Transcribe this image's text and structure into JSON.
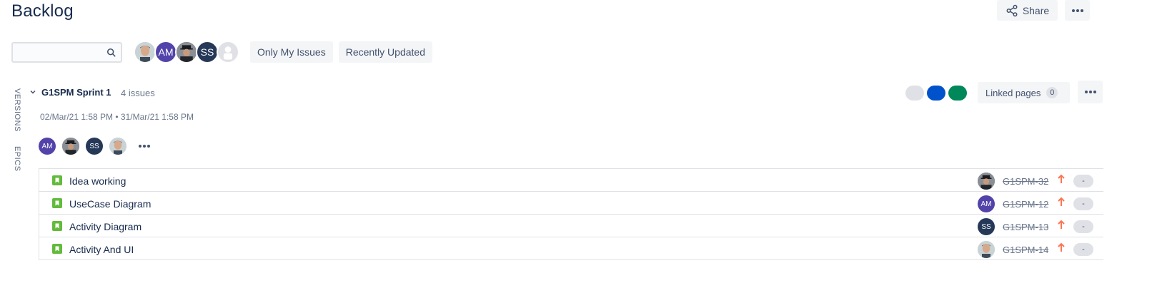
{
  "page": {
    "title": "Backlog"
  },
  "toolbar": {
    "share_label": "Share",
    "share_icon": "share-icon",
    "more_icon": "more-horizontal-icon"
  },
  "filters": {
    "search_placeholder": "",
    "search_value": "",
    "avatars": [
      {
        "kind": "photo",
        "name": "user-photo-1"
      },
      {
        "kind": "initials",
        "initials": "AM",
        "color": "#5243aa"
      },
      {
        "kind": "photo",
        "name": "user-photo-2"
      },
      {
        "kind": "initials",
        "initials": "SS",
        "color": "#253858"
      },
      {
        "kind": "placeholder",
        "name": "unassigned"
      }
    ],
    "quick_filters": [
      "Only My Issues",
      "Recently Updated"
    ]
  },
  "side_tabs": {
    "versions": "VERSIONS",
    "epics": "EPICS"
  },
  "sprint": {
    "name": "G1SPM Sprint 1",
    "issue_count": "4 issues",
    "dates": "02/Mar/21 1:58 PM  •  31/Mar/21 1:58 PM",
    "status_colors": {
      "todo": "#dfe1e6",
      "in_progress": "#0052cc",
      "done": "#00875a"
    },
    "linked_pages_label": "Linked pages",
    "linked_pages_count": "0",
    "members": [
      {
        "kind": "initials",
        "initials": "AM",
        "color": "#5243aa"
      },
      {
        "kind": "photo",
        "name": "user-photo-2"
      },
      {
        "kind": "initials",
        "initials": "SS",
        "color": "#253858"
      },
      {
        "kind": "photo",
        "name": "user-photo-1"
      }
    ]
  },
  "issues": [
    {
      "summary": "Idea working",
      "key": "G1SPM-32",
      "assignee": {
        "kind": "photo",
        "name": "user-photo-2"
      },
      "estimate": "-"
    },
    {
      "summary": "UseCase Diagram",
      "key": "G1SPM-12",
      "assignee": {
        "kind": "initials",
        "initials": "AM",
        "color": "#5243aa"
      },
      "estimate": "-"
    },
    {
      "summary": "Activity Diagram",
      "key": "G1SPM-13",
      "assignee": {
        "kind": "initials",
        "initials": "SS",
        "color": "#253858"
      },
      "estimate": "-"
    },
    {
      "summary": "Activity And UI",
      "key": "G1SPM-14",
      "assignee": {
        "kind": "photo",
        "name": "user-photo-1"
      },
      "estimate": "-"
    }
  ],
  "colors": {
    "story_green": "#63ba3c",
    "priority_orange": "#ff7452",
    "text_primary": "#172b4d",
    "text_subtle": "#6b778c"
  }
}
